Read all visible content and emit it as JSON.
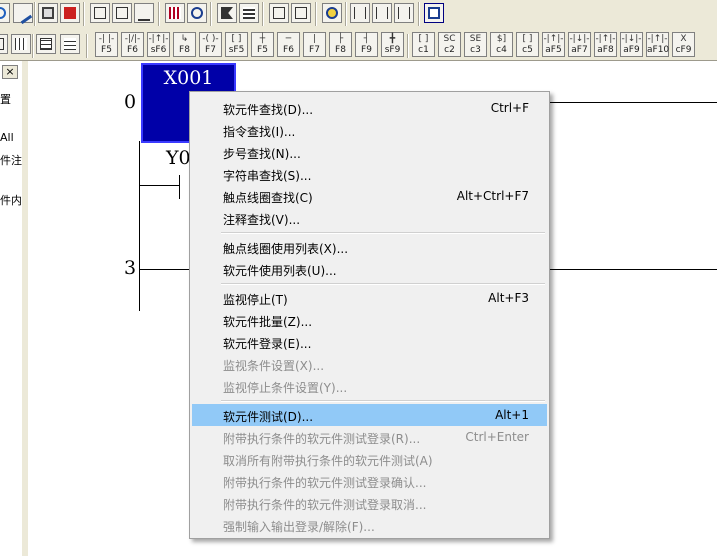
{
  "toolbar1": {
    "icons": [
      "write-icon",
      "print-icon",
      "delete-icon",
      "ladder-edit-icon",
      "ladder-edit-2-icon",
      "ladder-edit-3-icon",
      "device-grid-icon",
      "search-zoom-icon",
      "transfer-icon",
      "list-icon",
      "copy-icon",
      "paste-icon",
      "monitor-icon",
      "network-icon",
      "network-2-icon",
      "network-3-icon",
      "screen-icon"
    ]
  },
  "toolbar2": {
    "left_icons": [
      "cursor-icon",
      "grid-icon",
      "sort-icon"
    ],
    "fkeys": [
      {
        "sym": "-| |-",
        "label": "F5"
      },
      {
        "sym": "-|/|-",
        "label": "F6"
      },
      {
        "sym": "-|↑|-",
        "label": "sF6"
      },
      {
        "sym": "↳",
        "label": "F8"
      },
      {
        "sym": "-( )-",
        "label": "F7"
      },
      {
        "sym": "[ ]",
        "label": "sF5"
      },
      {
        "sym": "┼",
        "label": "F5"
      },
      {
        "sym": "─",
        "label": "F6"
      },
      {
        "sym": "|",
        "label": "F7"
      },
      {
        "sym": "├",
        "label": "F8"
      },
      {
        "sym": "┤",
        "label": "F9"
      },
      {
        "sym": "╋",
        "label": "sF9"
      },
      {
        "sym": "[ ]",
        "label": "c1"
      },
      {
        "sym": "SC",
        "label": "c2"
      },
      {
        "sym": "SE",
        "label": "c3"
      },
      {
        "sym": "$]",
        "label": "c4"
      },
      {
        "sym": "[ ]",
        "label": "c5"
      },
      {
        "sym": "-|↑|-",
        "label": "aF5"
      },
      {
        "sym": "-|↓|-",
        "label": "aF7"
      },
      {
        "sym": "-|↑|-",
        "label": "aF8"
      },
      {
        "sym": "-|↓|-",
        "label": "aF9"
      },
      {
        "sym": "-|↑|-",
        "label": "aF10"
      },
      {
        "sym": "X",
        "label": "cF9"
      }
    ]
  },
  "left_panel": {
    "close_label": "×",
    "fragments": [
      "置",
      "All",
      "件注",
      "件内"
    ]
  },
  "ladder": {
    "step0": "0",
    "step3": "3",
    "contact1": "X001",
    "contact2": "Y0"
  },
  "context_menu": {
    "items": [
      {
        "label": "软元件查找(D)...",
        "shortcut": "Ctrl+F"
      },
      {
        "label": "指令查找(I)...",
        "shortcut": ""
      },
      {
        "label": "步号查找(N)...",
        "shortcut": ""
      },
      {
        "label": "字符串查找(S)...",
        "shortcut": ""
      },
      {
        "label": "触点线圈查找(C)",
        "shortcut": "Alt+Ctrl+F7"
      },
      {
        "label": "注释查找(V)...",
        "shortcut": ""
      },
      {
        "label": "触点线圈使用列表(X)...",
        "shortcut": ""
      },
      {
        "label": "软元件使用列表(U)...",
        "shortcut": ""
      },
      {
        "label": "监视停止(T)",
        "shortcut": "Alt+F3"
      },
      {
        "label": "软元件批量(Z)...",
        "shortcut": ""
      },
      {
        "label": "软元件登录(E)...",
        "shortcut": ""
      },
      {
        "label": "监视条件设置(X)...",
        "shortcut": ""
      },
      {
        "label": "监视停止条件设置(Y)...",
        "shortcut": ""
      },
      {
        "label": "软元件测试(D)...",
        "shortcut": "Alt+1"
      },
      {
        "label": "附带执行条件的软元件测试登录(R)...",
        "shortcut": "Ctrl+Enter"
      },
      {
        "label": "取消所有附带执行条件的软元件测试(A)",
        "shortcut": ""
      },
      {
        "label": "附带执行条件的软元件测试登录确认...",
        "shortcut": ""
      },
      {
        "label": "附带执行条件的软元件测试登录取消...",
        "shortcut": ""
      },
      {
        "label": "强制输入输出登录/解除(F)...",
        "shortcut": ""
      }
    ]
  },
  "colors": {
    "highlight": "#91c9f7",
    "selected_contact": "#0000a8",
    "disabled_text": "#8d8d8d"
  }
}
